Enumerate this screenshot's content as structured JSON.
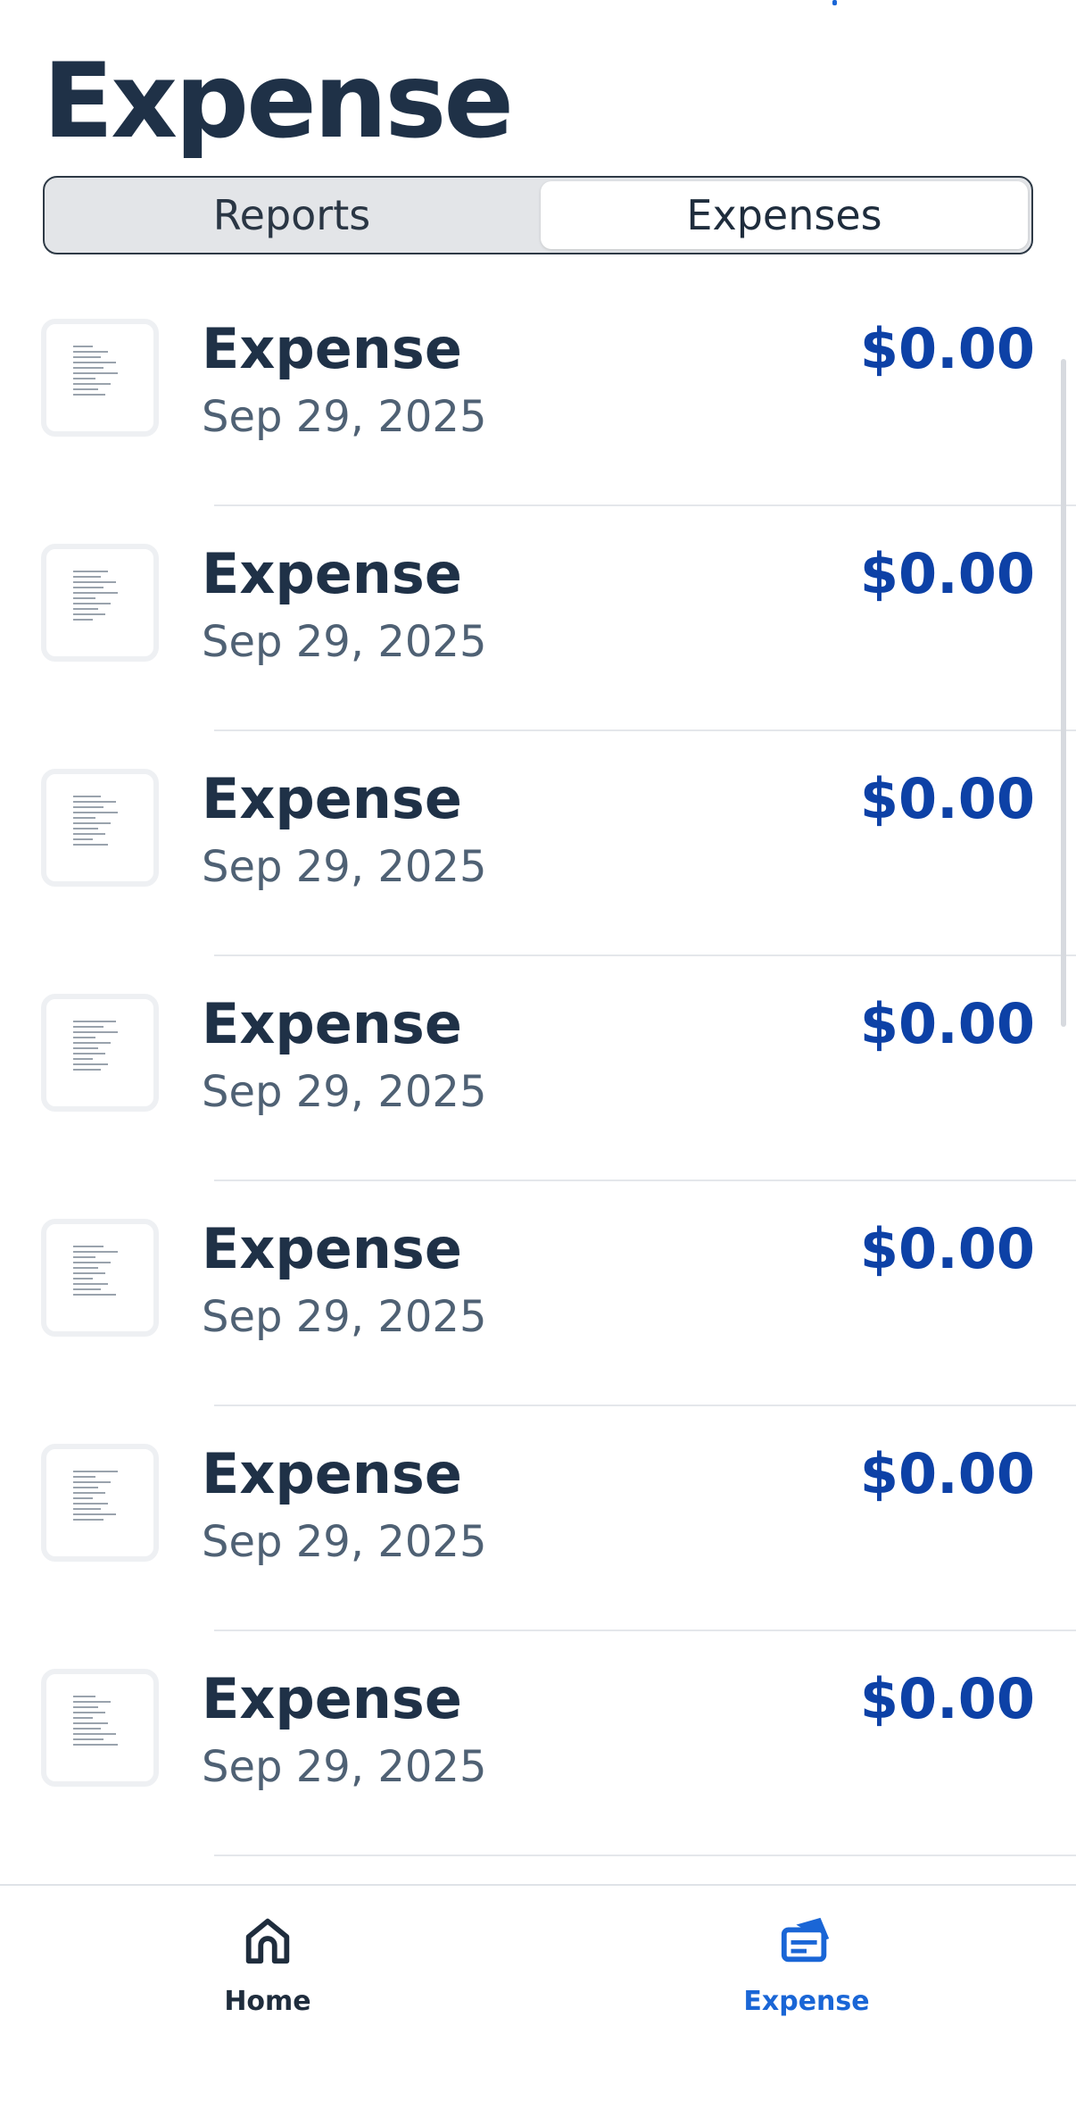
{
  "header": {
    "title": "Expense"
  },
  "segmented": {
    "tabs": [
      {
        "label": "Reports",
        "active": false
      },
      {
        "label": "Expenses",
        "active": true
      }
    ]
  },
  "expenses": [
    {
      "title": "Expense",
      "date": "Sep 29, 2025",
      "amount": "$0.00"
    },
    {
      "title": "Expense",
      "date": "Sep 29, 2025",
      "amount": "$0.00"
    },
    {
      "title": "Expense",
      "date": "Sep 29, 2025",
      "amount": "$0.00"
    },
    {
      "title": "Expense",
      "date": "Sep 29, 2025",
      "amount": "$0.00"
    },
    {
      "title": "Expense",
      "date": "Sep 29, 2025",
      "amount": "$0.00"
    },
    {
      "title": "Expense",
      "date": "Sep 29, 2025",
      "amount": "$0.00"
    },
    {
      "title": "Expense",
      "date": "Sep 29, 2025",
      "amount": "$0.00"
    }
  ],
  "tabbar": {
    "items": [
      {
        "label": "Home",
        "icon": "home-icon",
        "active": false
      },
      {
        "label": "Expense",
        "icon": "expense-card-icon",
        "active": true
      }
    ]
  },
  "colors": {
    "title": "#1f3147",
    "amount": "#0d41a6",
    "accent": "#1a66d6",
    "date": "#4f6174"
  }
}
